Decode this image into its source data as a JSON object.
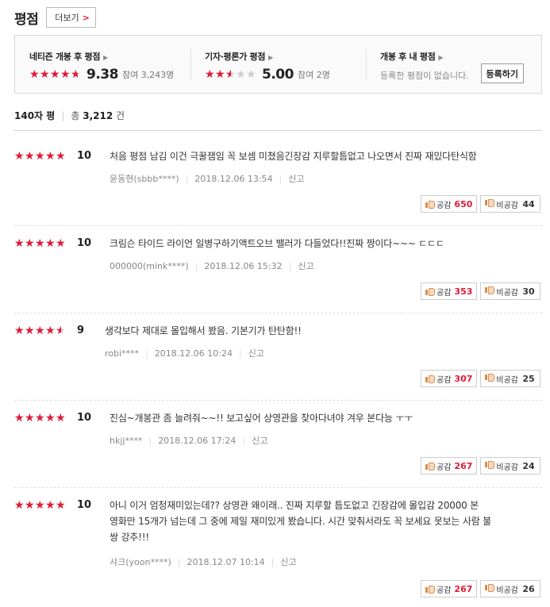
{
  "header": {
    "title": "평점",
    "more_label": "더보기",
    "more_chevron": ">"
  },
  "summary": {
    "netizen": {
      "label": "네티즌 개봉 후 평점",
      "score": "9.38",
      "count_text": "참여 3,243명",
      "rating": 9.38
    },
    "critic": {
      "label": "기자·평론가 평점",
      "score": "5.00",
      "count_text": "참여 2명",
      "rating": 5.0
    },
    "mine": {
      "label": "개봉 후 내 평점",
      "empty_text": "등록한 평점이 없습니다.",
      "register_label": "등록하기"
    },
    "arrow": "▶"
  },
  "filter": {
    "label": "140자 평",
    "total_prefix": "총",
    "total_count": "3,212",
    "total_suffix": "건"
  },
  "votes": {
    "up_label": "공감",
    "down_label": "비공감"
  },
  "report_label": "신고",
  "colors": {
    "accent": "#e31937"
  },
  "reviews": [
    {
      "score": "10",
      "rating": 10,
      "text": "처음 평점 남김 이건 극꿀잼임 꼭 보셈 미쳤음긴장감 지루할틈없고 나오면서 진짜 재밌다탄식함",
      "author": "윤동현(sbbb****)",
      "date": "2018.12.06 13:54",
      "up": "650",
      "down": "44"
    },
    {
      "score": "10",
      "rating": 10,
      "text": "크림슨 타이드 라이언 일병구하기액트오브 밸러가 다들었다!!진짜 짱이다~~~ ㄷㄷㄷ",
      "author": "000000(mink****)",
      "date": "2018.12.06 15:32",
      "up": "353",
      "down": "30"
    },
    {
      "score": "9",
      "rating": 9,
      "text": "생각보다 제대로 몰입해서 봤음. 기본기가 탄탄함!!",
      "author": "robi****",
      "date": "2018.12.06 10:24",
      "up": "307",
      "down": "25"
    },
    {
      "score": "10",
      "rating": 10,
      "text": "진심~개봉관 좀 늘려줘~~!! 보고싶어 상영관을 찾아다녀야 겨우 본다능 ㅜㅜ",
      "author": "hkjj****",
      "date": "2018.12.06 17:24",
      "up": "267",
      "down": "24"
    },
    {
      "score": "10",
      "rating": 10,
      "text_lines": [
        "아니 이거 엄청재미있는데?? 상영관 왜이래.. 진짜 지루할 틈도없고 긴장감에 몰입감 20000 본",
        "영화만 15개가 넘는데 그 중에 제일 재미있게 봤습니다. 시간 맞춰서라도 꼭 보세요 못보는 사람 불",
        "쌍 강추!!!"
      ],
      "author": "샤크(yoon****)",
      "date": "2018.12.07 10:14",
      "up": "267",
      "down": "26"
    }
  ]
}
